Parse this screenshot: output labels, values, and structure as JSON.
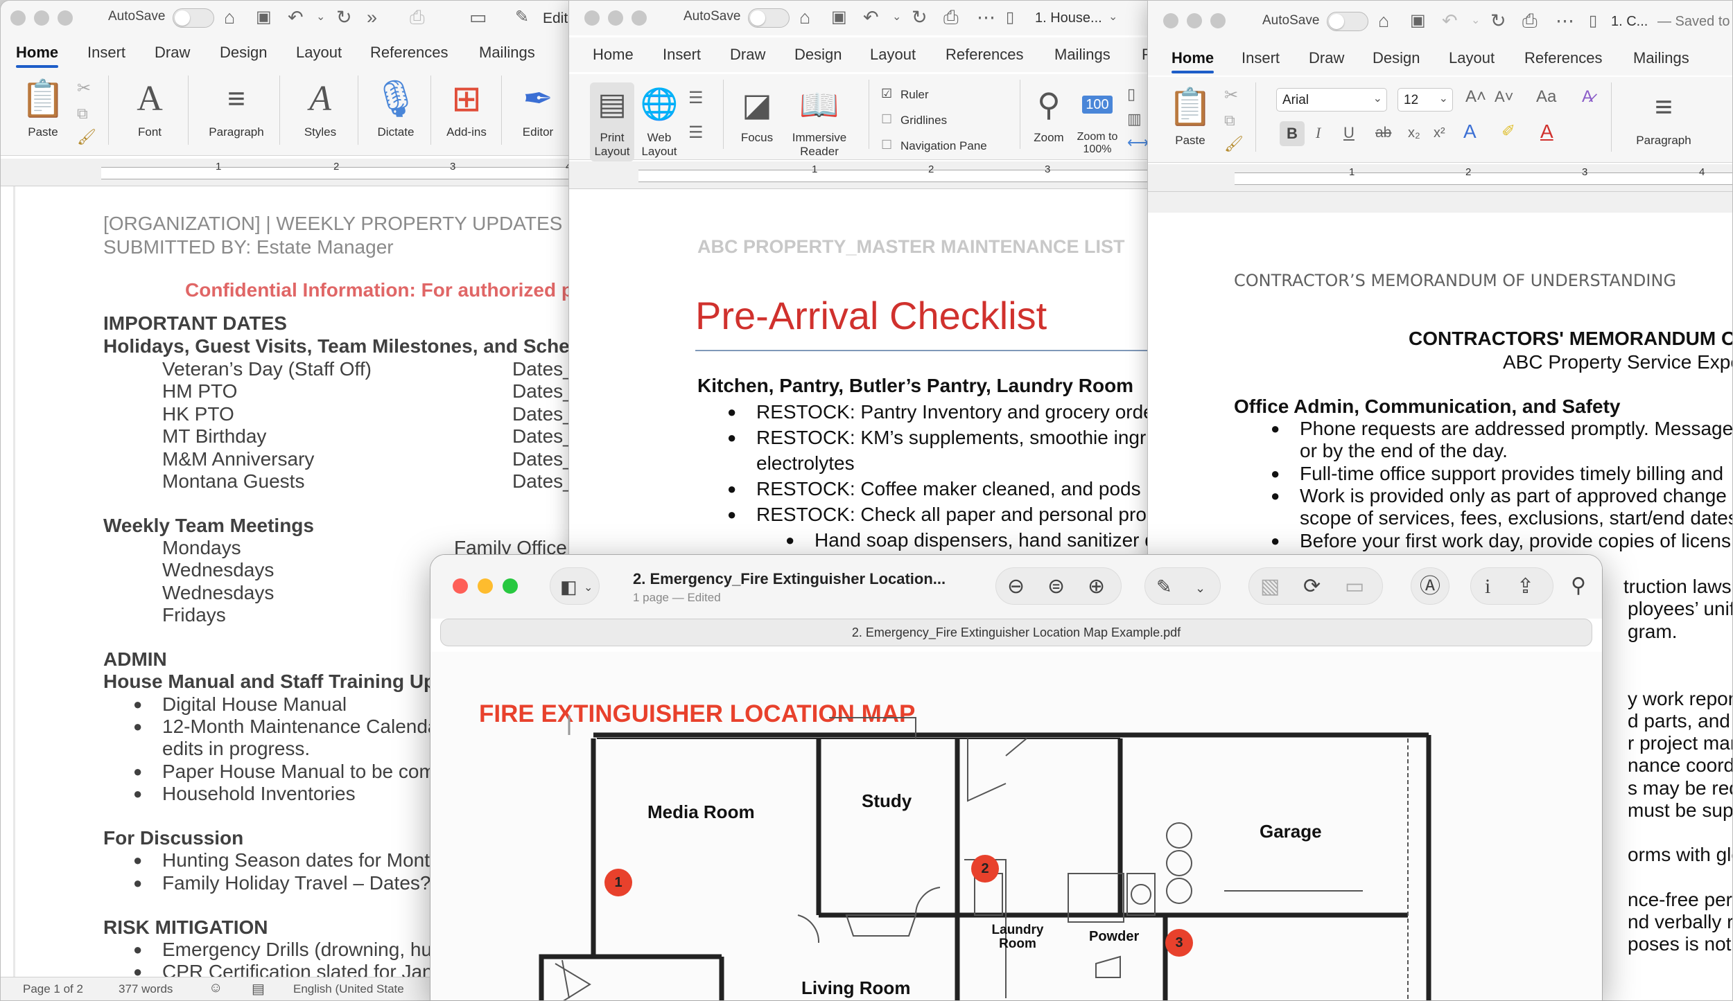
{
  "window1": {
    "autosave_label": "AutoSave",
    "edit_label": "Edit",
    "tabs": [
      "Home",
      "Insert",
      "Draw",
      "Design",
      "Layout",
      "References",
      "Mailings"
    ],
    "ribbon": [
      "Paste",
      "Font",
      "Paragraph",
      "Styles",
      "Dictate",
      "Add-ins",
      "Editor"
    ],
    "ruler_numbers": [
      "1",
      "2",
      "3",
      "4"
    ],
    "header_line1": "[ORGANIZATION] | WEEKLY PROPERTY UPDATES",
    "header_line2": "SUBMITTED BY: Estate Manager",
    "confidential": "Confidential Information: For authorized p",
    "important_dates": "IMPORTANT DATES",
    "holidays_heading": "Holidays, Guest Visits, Team Milestones, and Sche",
    "dates_rows": [
      {
        "label": "Veteran’s Day (Staff Off)",
        "value": "Dates_"
      },
      {
        "label": "HM PTO",
        "value": "Dates_"
      },
      {
        "label": "HK PTO",
        "value": "Dates_"
      },
      {
        "label": "MT Birthday",
        "value": "Dates_"
      },
      {
        "label": "M&M Anniversary",
        "value": "Dates_"
      },
      {
        "label": "Montana Guests",
        "value": "Dates_"
      }
    ],
    "meetings_heading": "Weekly Team Meetings",
    "meetings": [
      "Mondays",
      "Wednesdays",
      "Wednesdays",
      "Fridays"
    ],
    "family_office": "Family Office",
    "admin": "ADMIN",
    "house_manual_heading": "House Manual and Staff Training Up",
    "admin_bullets": [
      "Digital House Manual",
      "12-Month Maintenance Calenda",
      "edits in progress.",
      "Paper House Manual to be com",
      "Household Inventories"
    ],
    "discussion_heading": "For Discussion",
    "discussion_bullets": [
      "Hunting Season dates for Mont",
      "Family Holiday Travel – Dates?"
    ],
    "risk_heading": "RISK MITIGATION",
    "risk_bullets": [
      "Emergency Drills (drowning, hu",
      "CPR Certification slated for Jan"
    ],
    "status": {
      "page": "Page 1 of 2",
      "words": "377 words",
      "language": "English (United State"
    }
  },
  "window2": {
    "autosave_label": "AutoSave",
    "title": "1. House...",
    "tabs": [
      "Home",
      "Insert",
      "Draw",
      "Design",
      "Layout",
      "References",
      "Mailings",
      "R"
    ],
    "ribbon": {
      "print_layout": "Print Layout",
      "web_layout": "Web Layout",
      "focus": "Focus",
      "immersive_reader": "Immersive Reader",
      "ruler": "Ruler",
      "gridlines": "Gridlines",
      "navigation_pane": "Navigation Pane",
      "zoom": "Zoom",
      "zoom_100": "Zoom to 100%",
      "zoom_badge": "100"
    },
    "ruler_numbers": [
      "1",
      "2",
      "3"
    ],
    "header": "ABC PROPERTY_MASTER MAINTENANCE LIST",
    "title_heading": "Pre-Arrival Checklist",
    "section": "Kitchen, Pantry, Butler’s Pantry, Laundry Room",
    "bullets": [
      "RESTOCK: Pantry Inventory and grocery orde",
      "RESTOCK: KM’s supplements, smoothie ingr",
      "electrolytes",
      "RESTOCK: Coffee maker cleaned, and pods",
      "RESTOCK: Check all paper and personal pro"
    ],
    "sub_bullet": "Hand soap dispensers, hand sanitizer d"
  },
  "window3": {
    "autosave_label": "AutoSave",
    "title": "1. C...",
    "saved": "— Saved to",
    "tabs": [
      "Home",
      "Insert",
      "Draw",
      "Design",
      "Layout",
      "References",
      "Mailings"
    ],
    "ribbon": {
      "paste": "Paste",
      "font": "Arial",
      "size": "12",
      "paragraph": "Paragraph"
    },
    "ruler_numbers": [
      "1",
      "2",
      "3",
      "4"
    ],
    "header": "CONTRACTOR’S MEMORANDUM OF UNDERSTANDING",
    "title_line1": "CONTRACTORS' MEMORANDUM OF UN",
    "title_line2": "ABC Property Service Expectat",
    "section": "Office Admin, Communication, and Safety",
    "bullets": [
      "Phone requests are addressed promptly. Message",
      "or by the end of the day.",
      "Full-time office support provides timely billing and",
      "Work is provided only as part of approved change",
      "scope of services, fees, exclusions, start/end dates",
      "Before your first work day, provide copies of licens"
    ],
    "fragments": [
      "truction laws.",
      "ployees’ uniform",
      "gram.",
      "y work reports o",
      "d parts, and rec",
      "r project manag",
      "nance coordinat",
      "s may be require",
      "must be superv",
      "orms with glove",
      "nce-free perso",
      "nd verbally reite",
      "poses is not allo"
    ]
  },
  "preview": {
    "title": "2. Emergency_Fire Extinguisher Location...",
    "subtitle": "1 page — Edited",
    "tab_title": "2. Emergency_Fire Extinguisher Location Map Example.pdf",
    "map_title": "FIRE EXTINGUISHER LOCATION MAP",
    "rooms": [
      "Media Room",
      "Study",
      "Garage",
      "Laundry Room",
      "Powder",
      "Living Room"
    ],
    "markers": [
      "1",
      "2",
      "3"
    ]
  }
}
